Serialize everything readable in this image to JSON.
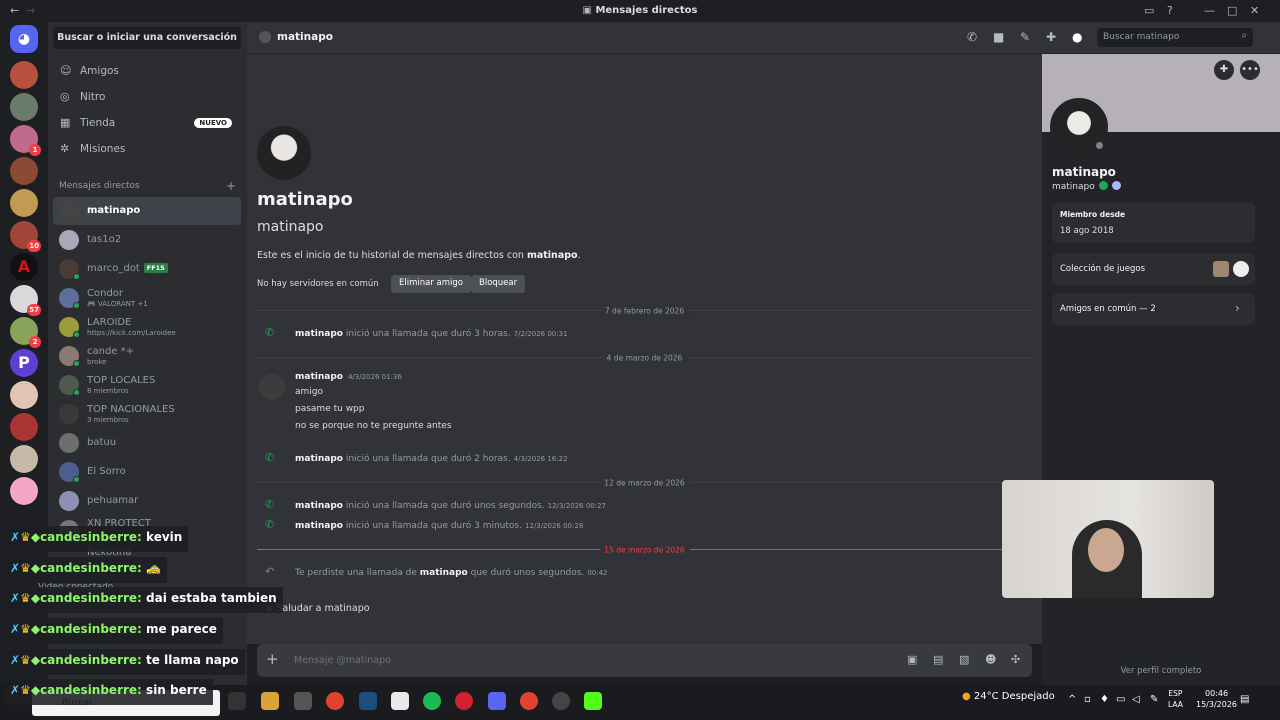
{
  "window": {
    "title": "Mensajes directos"
  },
  "colors": {
    "accent": "#5865f2",
    "online": "#23a55a",
    "danger": "#f23f43",
    "chat_name": "#8df56c"
  },
  "servers": {
    "badges": [
      "1",
      "10",
      "57",
      "2"
    ]
  },
  "sidebar": {
    "search": "Buscar o iniciar una conversación",
    "nav": [
      {
        "label": "Amigos",
        "icon": "friends-icon"
      },
      {
        "label": "Nitro",
        "icon": "nitro-icon"
      },
      {
        "label": "Tienda",
        "icon": "shop-icon",
        "badge": "NUEVO"
      },
      {
        "label": "Misiones",
        "icon": "quests-icon"
      }
    ],
    "dm_header": "Mensajes directos",
    "dms": [
      {
        "name": "matinapo",
        "sub": ""
      },
      {
        "name": "tas1o2",
        "sub": ""
      },
      {
        "name": "marco_dot",
        "sub": "",
        "tag": "FF15"
      },
      {
        "name": "Condor",
        "sub": "VALORANT +1"
      },
      {
        "name": "LAROIDE",
        "sub": "https://kick.com/Laroidee"
      },
      {
        "name": "cande *+",
        "sub": "broke"
      },
      {
        "name": "TOP LOCALES",
        "sub": "8 miembros"
      },
      {
        "name": "TOP NACIONALES",
        "sub": "3 miembros"
      },
      {
        "name": "batuu",
        "sub": ""
      },
      {
        "name": "El Sorro",
        "sub": ""
      },
      {
        "name": "pehuamar",
        "sub": ""
      },
      {
        "name": "XN PROTECT",
        "sub": ""
      },
      {
        "name": "Nekotina",
        "sub": ""
      }
    ],
    "voice_connected": "Vídeo conectado"
  },
  "header": {
    "name": "matinapo",
    "search_placeholder": "Buscar matinapo"
  },
  "chat": {
    "title": "matinapo",
    "subtitle": "matinapo",
    "intro_prefix": "Este es el inicio de tu historial de mensajes directos con ",
    "intro_name": "matinapo",
    "intro_suffix": ".",
    "no_servers": "No hay servidores en común",
    "remove_friend": "Eliminar amigo",
    "block": "Bloquear",
    "dividers": [
      "7 de febrero de 2026",
      "4 de marzo de 2026",
      "12 de marzo de 2026",
      "15 de marzo de 2026"
    ],
    "new_tag": "N",
    "call1": {
      "who": "matinapo",
      "text": "inició una llamada que duró 3 horas.",
      "time": "7/2/2026 00:31"
    },
    "msg": {
      "author": "matinapo",
      "time": "4/3/2026 01:36",
      "lines": [
        "amigo",
        "pasame tu wpp",
        "no se porque no te pregunte antes"
      ]
    },
    "call2": {
      "who": "matinapo",
      "text": "inició una llamada que duró 2 horas.",
      "time": "4/3/2026 16:22"
    },
    "call3": {
      "who": "matinapo",
      "text": "inició una llamada que duró unos segundos.",
      "time": "12/3/2026 00:27"
    },
    "call4": {
      "who": "matinapo",
      "text": "inició una llamada que duró 3 minutos.",
      "time": "12/3/2026 00:28"
    },
    "missed": {
      "prefix": "Te perdiste una llamada de",
      "who": "matinapo",
      "suffix": "que duró unos segundos.",
      "time": "00:42"
    },
    "greet": "Saludar a matinapo",
    "composer_placeholder": "Mensaje @matinapo"
  },
  "profile": {
    "name": "matinapo",
    "username": "matinapo",
    "member_since_label": "Miembro desde",
    "member_since": "18 ago 2018",
    "games_label": "Colección de juegos",
    "mutual_label": "Amigos en común — 2",
    "full_profile": "Ver perfil completo"
  },
  "overlay": [
    {
      "user": "candesinberre:",
      "msg": "kevin"
    },
    {
      "user": "candesinberre:",
      "msg": "🚕"
    },
    {
      "user": "candesinberre:",
      "msg": "dai estaba tambien"
    },
    {
      "user": "candesinberre:",
      "msg": "me parece"
    },
    {
      "user": "candesinberre:",
      "msg": "te llama napo"
    },
    {
      "user": "candesinberre:",
      "msg": "sin berre"
    }
  ],
  "taskbar": {
    "search": "Buscar",
    "weather": "24°C  Despejado",
    "lang1": "ESP",
    "lang2": "LAA",
    "time": "00:46",
    "date": "15/3/2026"
  }
}
